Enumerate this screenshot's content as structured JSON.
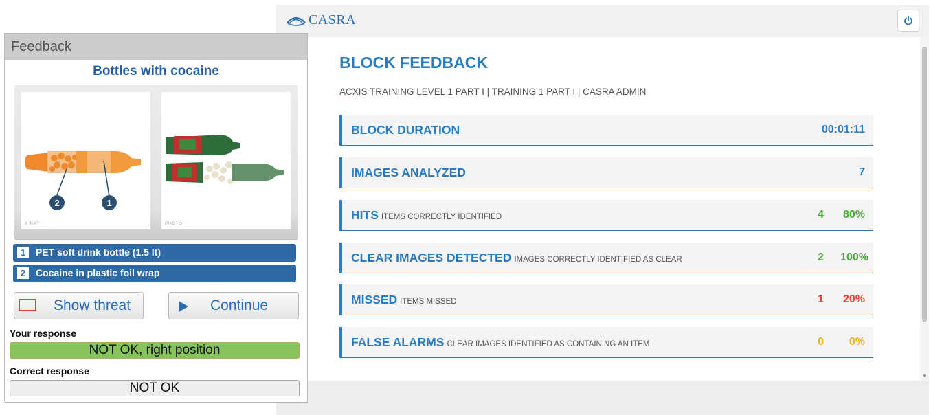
{
  "app": {
    "logo_text": "CASRA",
    "power_icon": "power-icon"
  },
  "block_feedback": {
    "title": "BLOCK FEEDBACK",
    "breadcrumb": "ACXIS TRAINING LEVEL 1 PART I | TRAINING 1 PART I | CASRA ADMIN",
    "stats": [
      {
        "label": "BLOCK DURATION",
        "sub": "",
        "count": "",
        "value": "00:01:11",
        "color": "#2b7bc0"
      },
      {
        "label": "IMAGES ANALYZED",
        "sub": "",
        "count": "",
        "value": "7",
        "color": "#2b7bc0"
      },
      {
        "label": "HITS",
        "sub": "ITEMS CORRECTLY IDENTIFIED",
        "count": "4",
        "value": "80%",
        "color": "#4caa3b"
      },
      {
        "label": "CLEAR IMAGES DETECTED",
        "sub": "IMAGES CORRECTLY IDENTIFIED AS CLEAR",
        "count": "2",
        "value": "100%",
        "color": "#4caa3b"
      },
      {
        "label": "MISSED",
        "sub": "ITEMS MISSED",
        "count": "1",
        "value": "20%",
        "color": "#e0432e"
      },
      {
        "label": "FALSE ALARMS",
        "sub": "CLEAR IMAGES IDENTIFIED AS CONTAINING AN ITEM",
        "count": "0",
        "value": "0%",
        "color": "#f2ad2b"
      }
    ]
  },
  "feedback_panel": {
    "header": "Feedback",
    "title": "Bottles with cocaine",
    "xray_caption": "X-RAY",
    "photo_caption": "PHOTO",
    "markers": [
      "1",
      "2"
    ],
    "threats": [
      {
        "num": "1",
        "text": "PET soft drink bottle (1.5 lt)"
      },
      {
        "num": "2",
        "text": "Cocaine in plastic foil wrap"
      }
    ],
    "show_threat_label": "Show threat",
    "continue_label": "Continue",
    "your_response_label": "Your response",
    "your_response_value": "NOT OK, right position",
    "correct_response_label": "Correct response",
    "correct_response_value": "NOT OK"
  }
}
